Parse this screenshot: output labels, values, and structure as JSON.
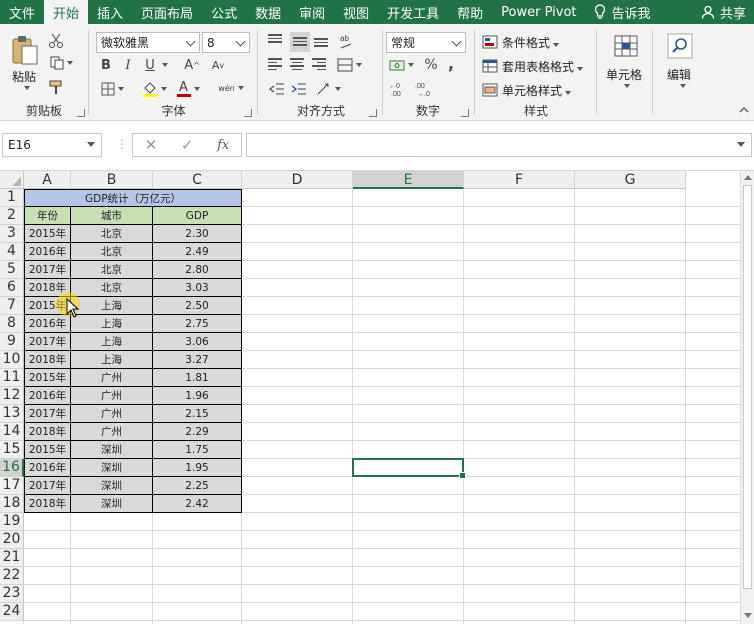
{
  "menu": {
    "tabs": [
      "文件",
      "开始",
      "插入",
      "页面布局",
      "公式",
      "数据",
      "审阅",
      "视图",
      "开发工具",
      "帮助",
      "Power Pivot"
    ],
    "active_tab": "开始",
    "tell_me": "告诉我",
    "share": "共享"
  },
  "ribbon": {
    "clipboard": {
      "paste": "粘贴",
      "label": "剪贴板"
    },
    "font": {
      "name": "微软雅黑",
      "size": "8",
      "bold": "B",
      "italic": "I",
      "underline": "U",
      "grow": "A",
      "shrink": "A",
      "pinyin": "wén",
      "label": "字体"
    },
    "alignment": {
      "label": "对齐方式"
    },
    "number": {
      "format": "常规",
      "percent": "%",
      "comma": ",",
      "label": "数字"
    },
    "styles": {
      "conditional": "条件格式",
      "table": "套用表格格式",
      "cell": "单元格样式",
      "label": "样式"
    },
    "cells": {
      "label": "单元格"
    },
    "editing": {
      "label": "编辑"
    }
  },
  "formula_bar": {
    "name_box": "E16",
    "fx": "fx",
    "formula": ""
  },
  "sheet": {
    "columns": [
      "A",
      "B",
      "C",
      "D",
      "E",
      "F",
      "G"
    ],
    "selected_column": "E",
    "rows": [
      "1",
      "2",
      "3",
      "4",
      "5",
      "6",
      "7",
      "8",
      "9",
      "10",
      "11",
      "12",
      "13",
      "14",
      "15",
      "16",
      "17",
      "18",
      "19",
      "20",
      "21",
      "22",
      "23",
      "24"
    ],
    "selected_row": "16",
    "title": "GDP统计（万亿元）",
    "headers": [
      "年份",
      "城市",
      "GDP"
    ],
    "data": [
      [
        "2015年",
        "北京",
        "2.30"
      ],
      [
        "2016年",
        "北京",
        "2.49"
      ],
      [
        "2017年",
        "北京",
        "2.80"
      ],
      [
        "2018年",
        "北京",
        "3.03"
      ],
      [
        "2015年",
        "上海",
        "2.50"
      ],
      [
        "2016年",
        "上海",
        "2.75"
      ],
      [
        "2017年",
        "上海",
        "3.06"
      ],
      [
        "2018年",
        "上海",
        "3.27"
      ],
      [
        "2015年",
        "广州",
        "1.81"
      ],
      [
        "2016年",
        "广州",
        "1.96"
      ],
      [
        "2017年",
        "广州",
        "2.15"
      ],
      [
        "2018年",
        "广州",
        "2.29"
      ],
      [
        "2015年",
        "深圳",
        "1.75"
      ],
      [
        "2016年",
        "深圳",
        "1.95"
      ],
      [
        "2017年",
        "深圳",
        "2.25"
      ],
      [
        "2018年",
        "深圳",
        "2.42"
      ]
    ]
  },
  "colors": {
    "accent": "#217346",
    "title_fill": "#b4c6e7",
    "header_fill": "#c6e0b4",
    "body_fill": "#d9d9d9"
  }
}
